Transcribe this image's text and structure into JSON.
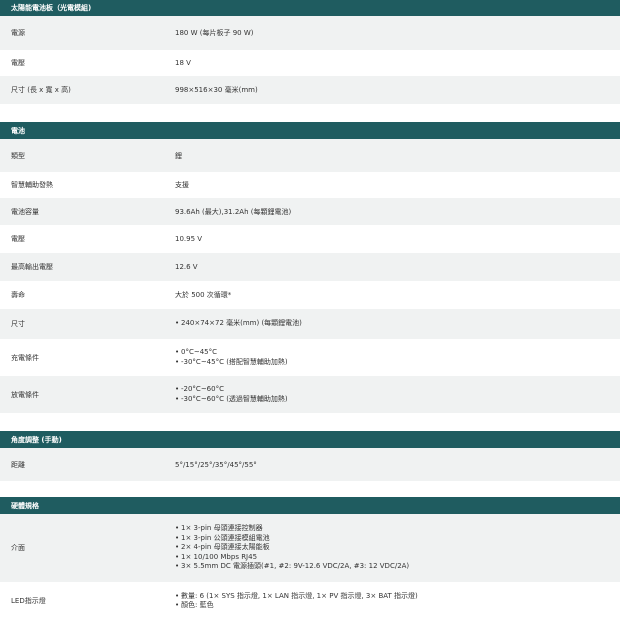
{
  "sections": [
    {
      "title": "太陽能電池板（光電模組)",
      "rows": [
        {
          "label": "電源",
          "value": "180 W (每片板子 90 W)"
        },
        {
          "label": "電壓",
          "value": "18 V"
        },
        {
          "label": "尺寸 (長 x 寬 x 高)",
          "value": "998×516×30 毫米(mm)"
        }
      ]
    },
    {
      "title": "電池",
      "rows": [
        {
          "label": "類型",
          "value": "鋰"
        },
        {
          "label": "智慧輔助發熱",
          "value": "支援"
        },
        {
          "label": "電池容量",
          "value": "93.6Ah (最大),31.2Ah (每顆鋰電池)"
        },
        {
          "label": "電壓",
          "value": "10.95 V"
        },
        {
          "label": "最高輸出電壓",
          "value": "12.6 V"
        },
        {
          "label": "壽命",
          "value": "大於 500 次循環*"
        },
        {
          "label": "尺寸",
          "bullets": [
            "240×74×72 毫米(mm) (每顆鋰電池)"
          ]
        },
        {
          "label": "充電條件",
          "bullets": [
            "0°C~45°C",
            "-30°C~45°C (搭配智慧輔助加熱)"
          ]
        },
        {
          "label": "放電條件",
          "bullets": [
            "-20°C~60°C",
            "-30°C~60°C (透過智慧輔助加熱)"
          ]
        }
      ]
    },
    {
      "title": "角度調整 (手動)",
      "rows": [
        {
          "label": "距離",
          "value": "5°/15°/25°/35°/45°/55°"
        }
      ]
    },
    {
      "title": "硬體規格",
      "rows": [
        {
          "label": "介面",
          "bullets": [
            "1× 3-pin 母頭連接控制器",
            "1× 3-pin 公頭連接模組電池",
            "2× 4-pin 母頭連接太陽能板",
            "1× 10/100 Mbps RJ45",
            "3× 5.5mm DC 電源插頭(#1, #2: 9V-12.6 VDC/2A, #3: 12 VDC/2A)"
          ]
        },
        {
          "label": "LED指示燈",
          "bullets": [
            "數量: 6 (1× SYS 指示燈, 1× LAN 指示燈, 1× PV 指示燈, 3× BAT 指示燈)",
            "顏色: 藍色"
          ]
        }
      ]
    }
  ],
  "colors": {
    "header_bg": "#1f5c60",
    "row_shade": "#f0f2f2",
    "text": "#333333"
  }
}
